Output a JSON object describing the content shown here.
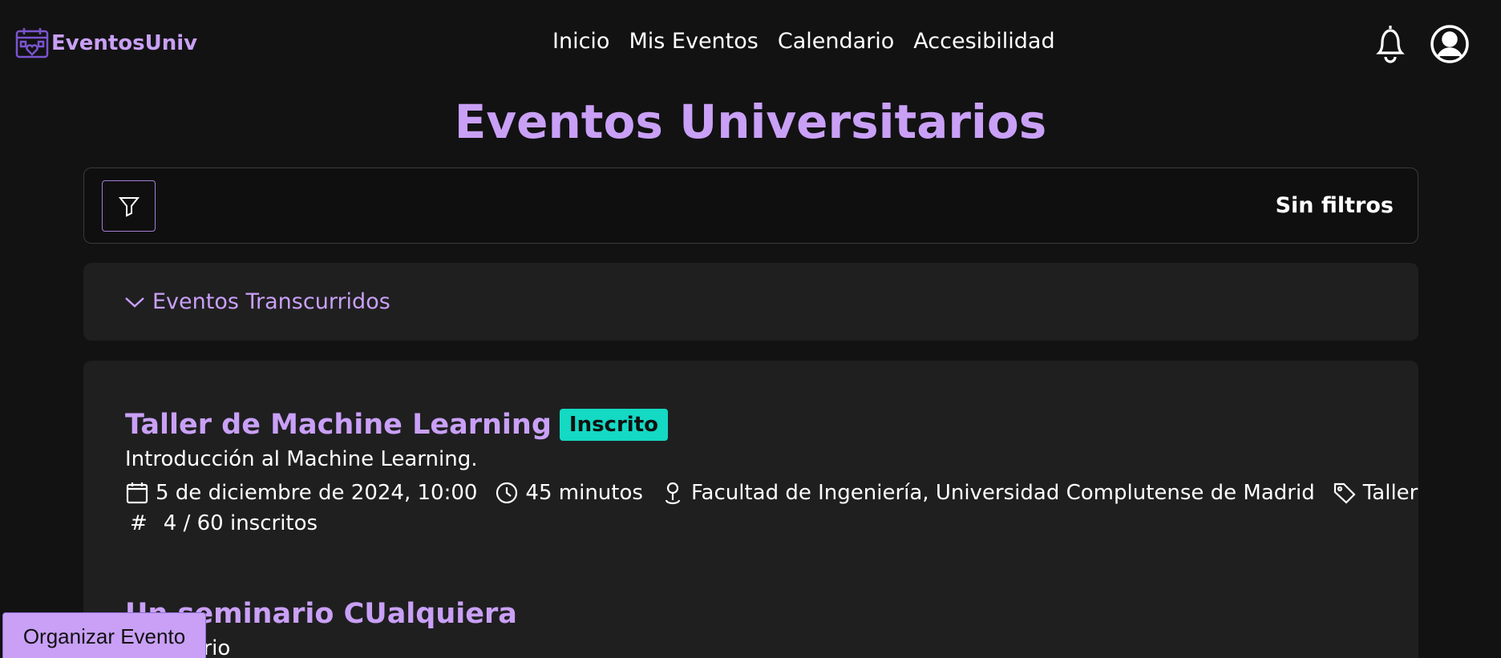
{
  "brand": {
    "name": "EventosUniv",
    "icon": "calendar-heart-icon"
  },
  "nav": {
    "links": [
      "Inicio",
      "Mis Eventos",
      "Calendario",
      "Accesibilidad"
    ],
    "icons": [
      "bell-icon",
      "user-icon"
    ]
  },
  "page": {
    "title": "Eventos Universitarios"
  },
  "filters": {
    "button_icon": "filter-icon",
    "status": "Sin filtros"
  },
  "past_events": {
    "label": "Eventos Transcurridos",
    "icon": "chevron-down-icon"
  },
  "events": [
    {
      "title": "Taller de Machine Learning",
      "badge": "Inscrito",
      "description": "Introducción al Machine Learning.",
      "date": "5 de diciembre de 2024, 10:00",
      "duration": "45 minutos",
      "location": "Facultad de Ingeniería, Universidad Complutense de Madrid",
      "category": "Taller",
      "count_symbol": "#",
      "enrolled": "4 / 60 inscritos"
    },
    {
      "title": "Un seminario CUalquiera",
      "description": "Seminario"
    }
  ],
  "colors": {
    "accent": "#c9a0f6",
    "badge": "#14d9c3",
    "background": "#121213",
    "panel": "#1f1f20"
  },
  "actions": {
    "organize": "Organizar Evento"
  }
}
